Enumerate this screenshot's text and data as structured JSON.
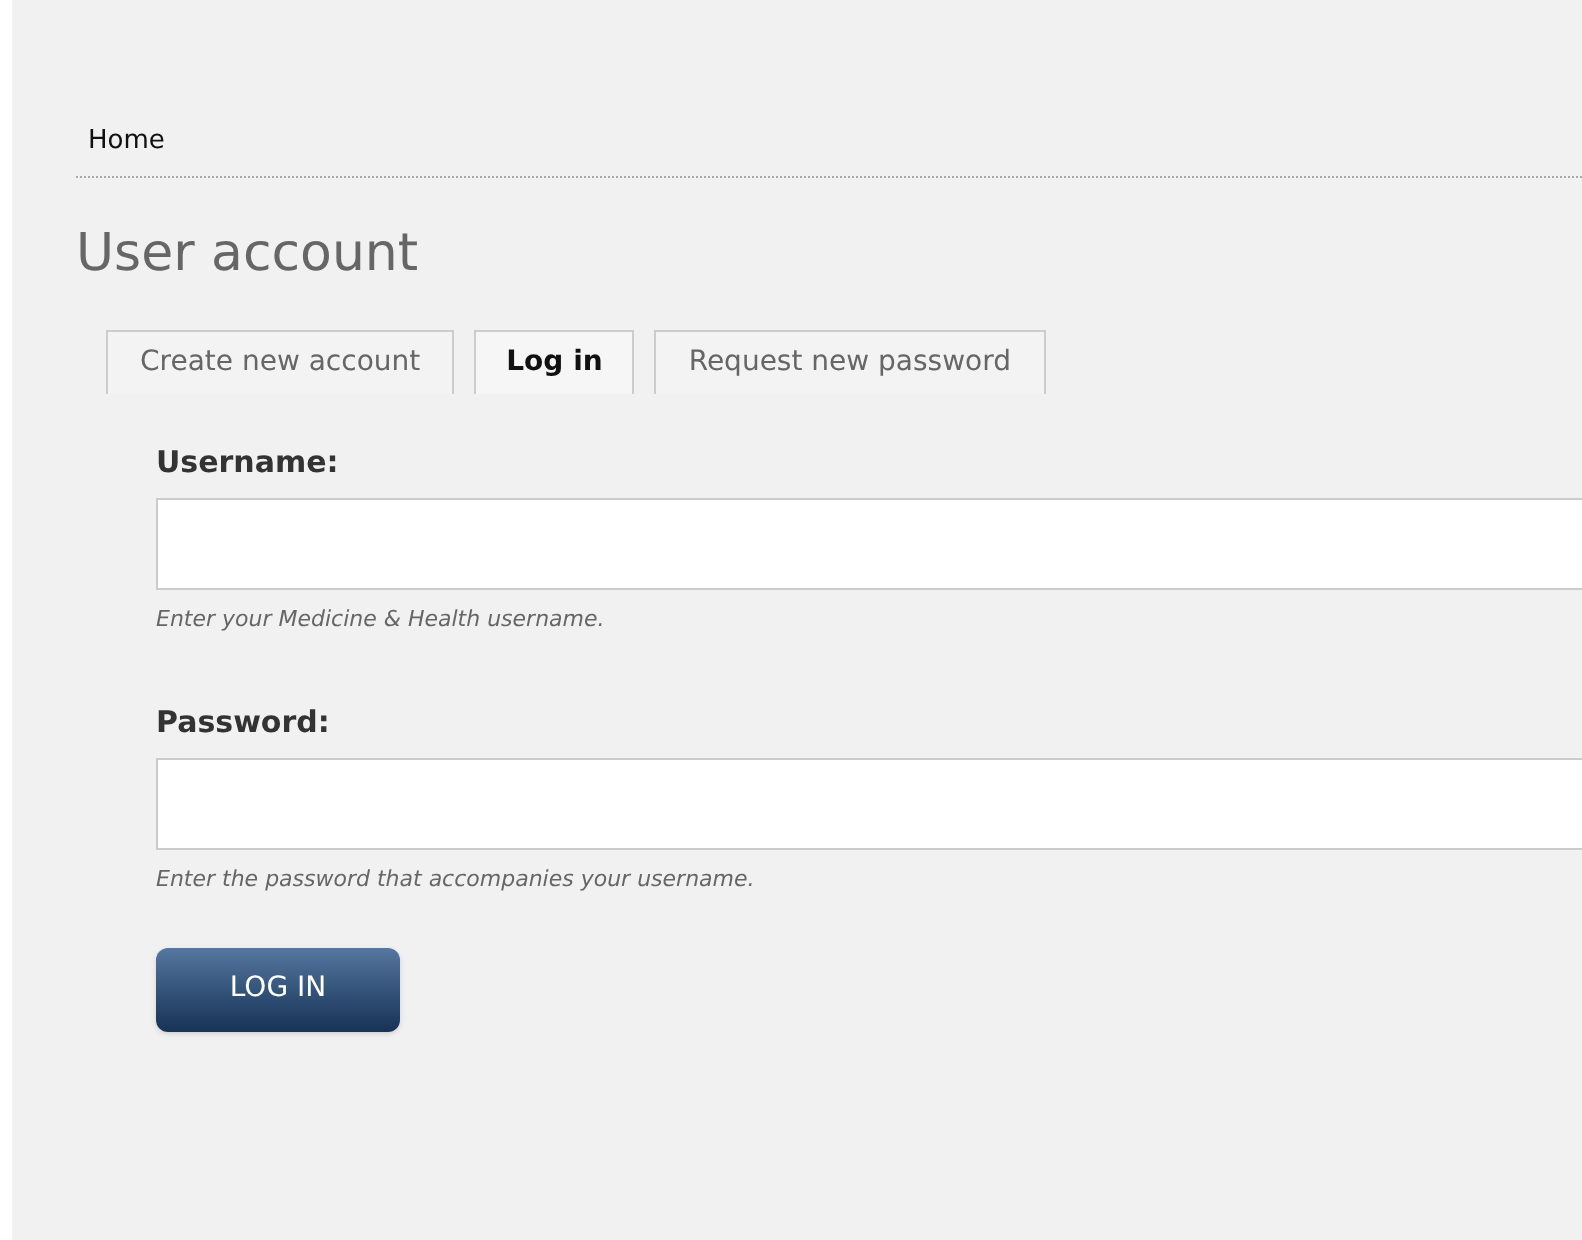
{
  "breadcrumb": [
    {
      "label": "Home"
    }
  ],
  "title": "User account",
  "tabs": [
    {
      "label": "Create new account",
      "selected": false
    },
    {
      "label": "Log in",
      "selected": true
    },
    {
      "label": "Request new password",
      "selected": false
    }
  ],
  "fields": [
    {
      "label": "Username:",
      "help": "Enter your Medicine & Health username."
    },
    {
      "label": "Password:",
      "help": "Enter the password that accompanies your username."
    }
  ],
  "submit": "LOG IN"
}
